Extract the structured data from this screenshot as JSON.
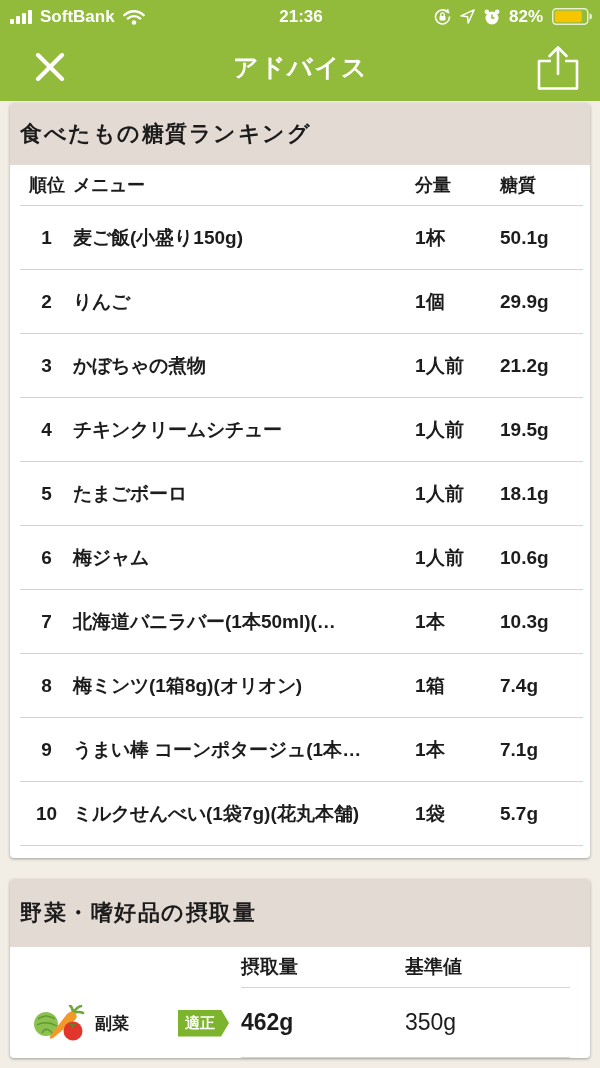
{
  "status_bar": {
    "carrier": "SoftBank",
    "time": "21:36",
    "battery": "82%"
  },
  "nav_bar": {
    "title": "アドバイス"
  },
  "ranking": {
    "title": "食べたもの糖質ランキング",
    "columns": [
      "順位",
      "メニュー",
      "分量",
      "糖質"
    ],
    "rows": [
      {
        "rank": "1",
        "menu": "麦ご飯(小盛り150g)",
        "amount": "1杯",
        "sugar": "50.1g"
      },
      {
        "rank": "2",
        "menu": "りんご",
        "amount": "1個",
        "sugar": "29.9g"
      },
      {
        "rank": "3",
        "menu": "かぼちゃの煮物",
        "amount": "1人前",
        "sugar": "21.2g"
      },
      {
        "rank": "4",
        "menu": "チキンクリームシチュー",
        "amount": "1人前",
        "sugar": "19.5g"
      },
      {
        "rank": "5",
        "menu": "たまごボーロ",
        "amount": "1人前",
        "sugar": "18.1g"
      },
      {
        "rank": "6",
        "menu": "梅ジャム",
        "amount": "1人前",
        "sugar": "10.6g"
      },
      {
        "rank": "7",
        "menu": "北海道バニラバー(1本50ml)(…",
        "amount": "1本",
        "sugar": "10.3g"
      },
      {
        "rank": "8",
        "menu": "梅ミンツ(1箱8g)(オリオン)",
        "amount": "1箱",
        "sugar": "7.4g"
      },
      {
        "rank": "9",
        "menu": "うまい棒 コーンポタージュ(1本…",
        "amount": "1本",
        "sugar": "7.1g"
      },
      {
        "rank": "10",
        "menu": "ミルクせんべい(1袋7g)(花丸本舗)",
        "amount": "1袋",
        "sugar": "5.7g"
      }
    ]
  },
  "intake": {
    "title": "野菜・嗜好品の摂取量",
    "columns": [
      "摂取量",
      "基準値"
    ],
    "rows": [
      {
        "name": "副菜",
        "status": "適正",
        "intake": "462g",
        "standard": "350g"
      }
    ]
  }
}
